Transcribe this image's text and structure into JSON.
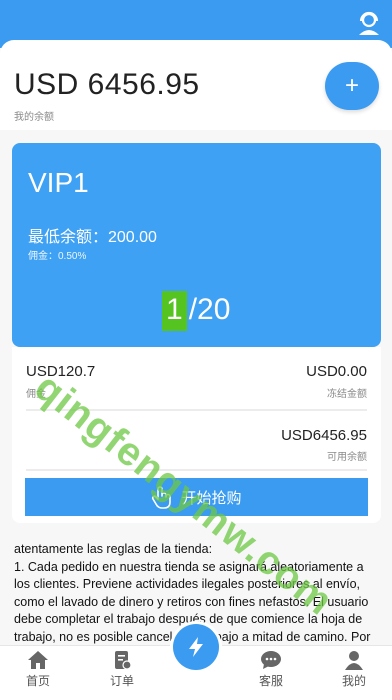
{
  "header": {
    "balance": "USD 6456.95",
    "balance_label": "我的余额",
    "add_label": "+"
  },
  "vip": {
    "level": "VIP1",
    "min_balance": "最低余额：200.00",
    "commission_rate": "佣金：0.50%",
    "progress_current": "1",
    "progress_total": "/20"
  },
  "stats": {
    "commission_value": "USD120.7",
    "commission_label": "佣金",
    "frozen_value": "USD0.00",
    "frozen_label": "冻结金额",
    "available_value": "USD6456.95",
    "available_label": "可用余额",
    "start_button": "开始抢购"
  },
  "rules": [
    " atentamente las reglas de la tienda:",
    "1. Cada pedido en nuestra tienda se asignará aleatoriamente a los clientes. Previene actividades ilegales posteriores al envío, como el lavado de dinero y retiros con fines nefastos. El usuario debe completar el trabajo después de que comience la hoja de trabajo, no es posible cancelar el trabajo a mitad de camino. Por el contrario, el sistema no"
  ],
  "tabs": [
    {
      "label": "首页",
      "icon": "home-icon"
    },
    {
      "label": "订单",
      "icon": "orders-icon"
    },
    {
      "label": "客服",
      "icon": "chat-icon"
    },
    {
      "label": "我的",
      "icon": "profile-icon"
    }
  ],
  "watermark": "qingfengymw.com",
  "colors": {
    "primary": "#3a9bf0",
    "vip_card": "#3fa1f3",
    "progress_highlight": "#55c320",
    "watermark": "#6ec846"
  }
}
